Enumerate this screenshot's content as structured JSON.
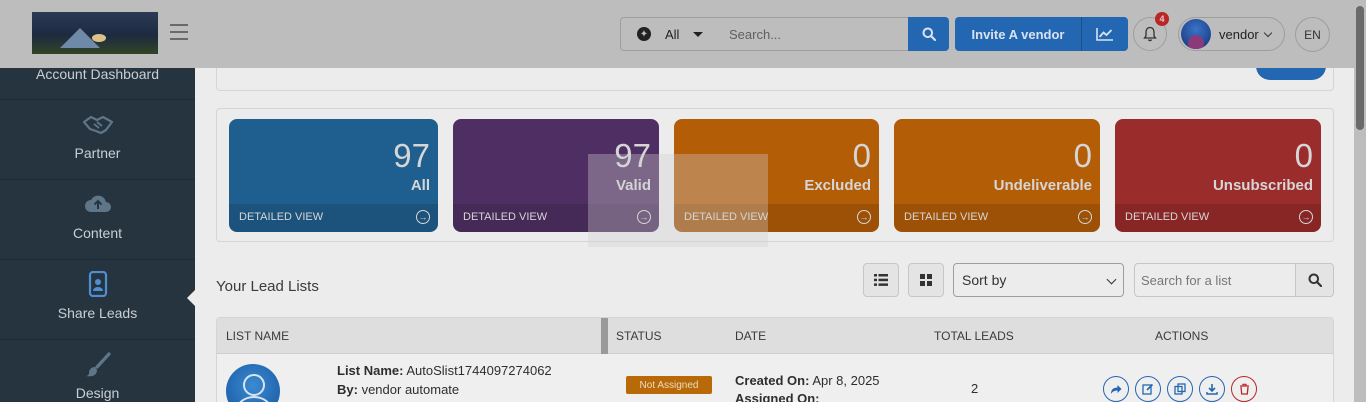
{
  "header": {
    "filter_label": "All",
    "search_placeholder": "Search...",
    "invite_label": "Invite A vendor",
    "notification_count": "4",
    "user_name": "vendor",
    "language": "EN"
  },
  "sidebar": {
    "items": [
      {
        "label": "Account Dashboard",
        "icon": "dashboard-icon"
      },
      {
        "label": "Partner",
        "icon": "handshake-icon"
      },
      {
        "label": "Content",
        "icon": "cloud-upload-icon"
      },
      {
        "label": "Share Leads",
        "icon": "share-leads-icon",
        "active": true
      },
      {
        "label": "Design",
        "icon": "brush-icon"
      }
    ]
  },
  "stats": {
    "detailed_view": "DETAILED VIEW",
    "cards": [
      {
        "value": "97",
        "label": "All",
        "color": "#1f5f8f"
      },
      {
        "value": "97",
        "label": "Valid",
        "color": "#4f2f63"
      },
      {
        "value": "0",
        "label": "Excluded",
        "color": "#b35d07"
      },
      {
        "value": "0",
        "label": "Undeliverable",
        "color": "#b35d07"
      },
      {
        "value": "0",
        "label": "Unsubscribed",
        "color": "#9b2c2c"
      }
    ]
  },
  "lists": {
    "title": "Your Lead Lists",
    "sort_label": "Sort by",
    "search_placeholder": "Search for a list",
    "columns": [
      "LIST NAME",
      "STATUS",
      "DATE",
      "TOTAL LEADS",
      "ACTIONS"
    ],
    "rows": [
      {
        "list_name_label": "List Name:",
        "list_name": "AutoSlist1744097274062",
        "by_label": "By:",
        "by": "vendor automate",
        "status": "Not Assigned",
        "created_label": "Created On:",
        "created": "Apr 8, 2025",
        "assigned_label": "Assigned On:",
        "total_leads": "2"
      }
    ]
  },
  "colors": {
    "primary": "#2366b2",
    "sidebar": "#26343f",
    "danger": "#b92626",
    "status_not_assigned": "#b96a08"
  }
}
